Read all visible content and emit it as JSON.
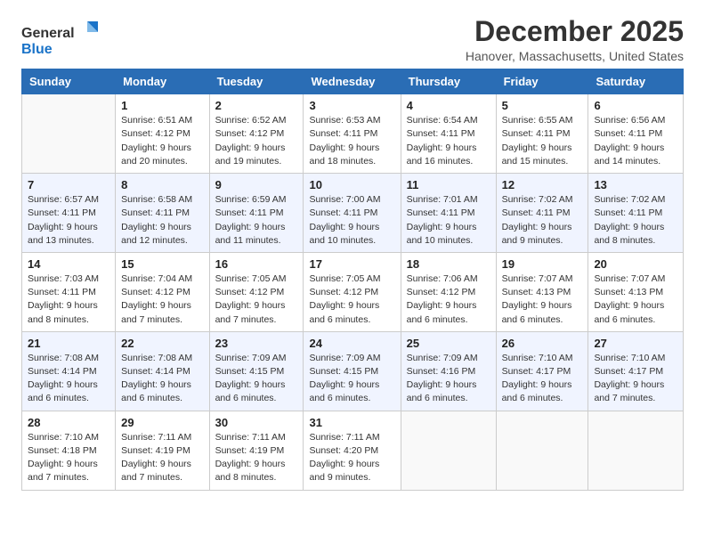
{
  "logo": {
    "line1": "General",
    "line2": "Blue"
  },
  "header": {
    "title": "December 2025",
    "subtitle": "Hanover, Massachusetts, United States"
  },
  "weekdays": [
    "Sunday",
    "Monday",
    "Tuesday",
    "Wednesday",
    "Thursday",
    "Friday",
    "Saturday"
  ],
  "weeks": [
    [
      {
        "day": "",
        "sunrise": "",
        "sunset": "",
        "daylight": ""
      },
      {
        "day": "1",
        "sunrise": "Sunrise: 6:51 AM",
        "sunset": "Sunset: 4:12 PM",
        "daylight": "Daylight: 9 hours and 20 minutes."
      },
      {
        "day": "2",
        "sunrise": "Sunrise: 6:52 AM",
        "sunset": "Sunset: 4:12 PM",
        "daylight": "Daylight: 9 hours and 19 minutes."
      },
      {
        "day": "3",
        "sunrise": "Sunrise: 6:53 AM",
        "sunset": "Sunset: 4:11 PM",
        "daylight": "Daylight: 9 hours and 18 minutes."
      },
      {
        "day": "4",
        "sunrise": "Sunrise: 6:54 AM",
        "sunset": "Sunset: 4:11 PM",
        "daylight": "Daylight: 9 hours and 16 minutes."
      },
      {
        "day": "5",
        "sunrise": "Sunrise: 6:55 AM",
        "sunset": "Sunset: 4:11 PM",
        "daylight": "Daylight: 9 hours and 15 minutes."
      },
      {
        "day": "6",
        "sunrise": "Sunrise: 6:56 AM",
        "sunset": "Sunset: 4:11 PM",
        "daylight": "Daylight: 9 hours and 14 minutes."
      }
    ],
    [
      {
        "day": "7",
        "sunrise": "Sunrise: 6:57 AM",
        "sunset": "Sunset: 4:11 PM",
        "daylight": "Daylight: 9 hours and 13 minutes."
      },
      {
        "day": "8",
        "sunrise": "Sunrise: 6:58 AM",
        "sunset": "Sunset: 4:11 PM",
        "daylight": "Daylight: 9 hours and 12 minutes."
      },
      {
        "day": "9",
        "sunrise": "Sunrise: 6:59 AM",
        "sunset": "Sunset: 4:11 PM",
        "daylight": "Daylight: 9 hours and 11 minutes."
      },
      {
        "day": "10",
        "sunrise": "Sunrise: 7:00 AM",
        "sunset": "Sunset: 4:11 PM",
        "daylight": "Daylight: 9 hours and 10 minutes."
      },
      {
        "day": "11",
        "sunrise": "Sunrise: 7:01 AM",
        "sunset": "Sunset: 4:11 PM",
        "daylight": "Daylight: 9 hours and 10 minutes."
      },
      {
        "day": "12",
        "sunrise": "Sunrise: 7:02 AM",
        "sunset": "Sunset: 4:11 PM",
        "daylight": "Daylight: 9 hours and 9 minutes."
      },
      {
        "day": "13",
        "sunrise": "Sunrise: 7:02 AM",
        "sunset": "Sunset: 4:11 PM",
        "daylight": "Daylight: 9 hours and 8 minutes."
      }
    ],
    [
      {
        "day": "14",
        "sunrise": "Sunrise: 7:03 AM",
        "sunset": "Sunset: 4:11 PM",
        "daylight": "Daylight: 9 hours and 8 minutes."
      },
      {
        "day": "15",
        "sunrise": "Sunrise: 7:04 AM",
        "sunset": "Sunset: 4:12 PM",
        "daylight": "Daylight: 9 hours and 7 minutes."
      },
      {
        "day": "16",
        "sunrise": "Sunrise: 7:05 AM",
        "sunset": "Sunset: 4:12 PM",
        "daylight": "Daylight: 9 hours and 7 minutes."
      },
      {
        "day": "17",
        "sunrise": "Sunrise: 7:05 AM",
        "sunset": "Sunset: 4:12 PM",
        "daylight": "Daylight: 9 hours and 6 minutes."
      },
      {
        "day": "18",
        "sunrise": "Sunrise: 7:06 AM",
        "sunset": "Sunset: 4:12 PM",
        "daylight": "Daylight: 9 hours and 6 minutes."
      },
      {
        "day": "19",
        "sunrise": "Sunrise: 7:07 AM",
        "sunset": "Sunset: 4:13 PM",
        "daylight": "Daylight: 9 hours and 6 minutes."
      },
      {
        "day": "20",
        "sunrise": "Sunrise: 7:07 AM",
        "sunset": "Sunset: 4:13 PM",
        "daylight": "Daylight: 9 hours and 6 minutes."
      }
    ],
    [
      {
        "day": "21",
        "sunrise": "Sunrise: 7:08 AM",
        "sunset": "Sunset: 4:14 PM",
        "daylight": "Daylight: 9 hours and 6 minutes."
      },
      {
        "day": "22",
        "sunrise": "Sunrise: 7:08 AM",
        "sunset": "Sunset: 4:14 PM",
        "daylight": "Daylight: 9 hours and 6 minutes."
      },
      {
        "day": "23",
        "sunrise": "Sunrise: 7:09 AM",
        "sunset": "Sunset: 4:15 PM",
        "daylight": "Daylight: 9 hours and 6 minutes."
      },
      {
        "day": "24",
        "sunrise": "Sunrise: 7:09 AM",
        "sunset": "Sunset: 4:15 PM",
        "daylight": "Daylight: 9 hours and 6 minutes."
      },
      {
        "day": "25",
        "sunrise": "Sunrise: 7:09 AM",
        "sunset": "Sunset: 4:16 PM",
        "daylight": "Daylight: 9 hours and 6 minutes."
      },
      {
        "day": "26",
        "sunrise": "Sunrise: 7:10 AM",
        "sunset": "Sunset: 4:17 PM",
        "daylight": "Daylight: 9 hours and 6 minutes."
      },
      {
        "day": "27",
        "sunrise": "Sunrise: 7:10 AM",
        "sunset": "Sunset: 4:17 PM",
        "daylight": "Daylight: 9 hours and 7 minutes."
      }
    ],
    [
      {
        "day": "28",
        "sunrise": "Sunrise: 7:10 AM",
        "sunset": "Sunset: 4:18 PM",
        "daylight": "Daylight: 9 hours and 7 minutes."
      },
      {
        "day": "29",
        "sunrise": "Sunrise: 7:11 AM",
        "sunset": "Sunset: 4:19 PM",
        "daylight": "Daylight: 9 hours and 7 minutes."
      },
      {
        "day": "30",
        "sunrise": "Sunrise: 7:11 AM",
        "sunset": "Sunset: 4:19 PM",
        "daylight": "Daylight: 9 hours and 8 minutes."
      },
      {
        "day": "31",
        "sunrise": "Sunrise: 7:11 AM",
        "sunset": "Sunset: 4:20 PM",
        "daylight": "Daylight: 9 hours and 9 minutes."
      },
      {
        "day": "",
        "sunrise": "",
        "sunset": "",
        "daylight": ""
      },
      {
        "day": "",
        "sunrise": "",
        "sunset": "",
        "daylight": ""
      },
      {
        "day": "",
        "sunrise": "",
        "sunset": "",
        "daylight": ""
      }
    ]
  ]
}
